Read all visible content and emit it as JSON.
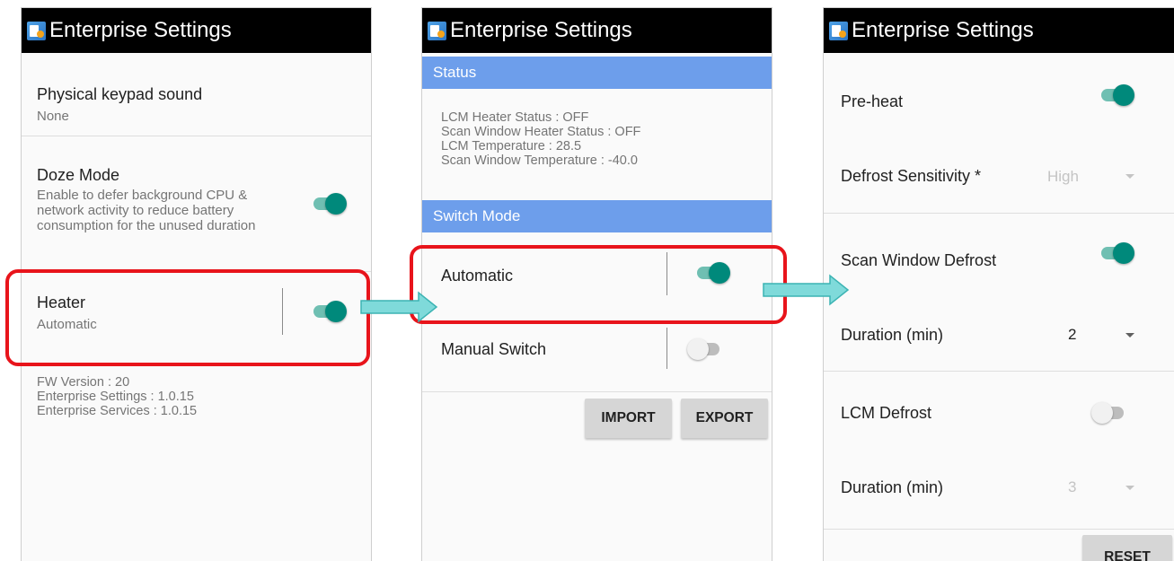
{
  "app_title": "Enterprise Settings",
  "screen1": {
    "keypad": {
      "title": "Physical keypad sound",
      "summary": "None"
    },
    "doze": {
      "title": "Doze Mode",
      "summary": "Enable to defer background CPU & network activity to reduce battery consumption for the unused duration",
      "enabled": true
    },
    "heater": {
      "title": "Heater",
      "summary": "Automatic",
      "enabled": true
    },
    "versions": [
      "FW Version : 20",
      "Enterprise Settings : 1.0.15",
      "Enterprise Services : 1.0.15"
    ]
  },
  "screen2": {
    "status_header": "Status",
    "status_lines": [
      "LCM Heater Status : OFF",
      "Scan Window Heater Status : OFF",
      "LCM Temperature : 28.5",
      "Scan Window Temperature : -40.0"
    ],
    "switch_mode_header": "Switch Mode",
    "automatic": {
      "label": "Automatic",
      "enabled": true
    },
    "manual": {
      "label": "Manual Switch",
      "enabled": false
    },
    "import_label": "IMPORT",
    "export_label": "EXPORT"
  },
  "screen3": {
    "preheat": {
      "label": "Pre-heat",
      "enabled": true
    },
    "defrost_sensitivity": {
      "label": "Defrost Sensitivity *",
      "value": "High",
      "enabled": false
    },
    "scan_window_defrost": {
      "label": "Scan Window Defrost",
      "enabled": true
    },
    "scan_duration": {
      "label": "Duration (min)",
      "value": "2",
      "enabled": true
    },
    "lcm_defrost": {
      "label": "LCM Defrost",
      "enabled": false
    },
    "lcm_duration": {
      "label": "Duration (min)",
      "value": "3",
      "enabled": false
    },
    "reset_label": "RESET"
  },
  "colors": {
    "titlebar": "#000000",
    "section_header": "#6d9eeb",
    "switch_on": "#00897b",
    "highlight": "#e8141b",
    "arrow": "#7fdada"
  },
  "icons": [
    "app-icon",
    "dropdown-caret-icon",
    "right-arrow-icon"
  ]
}
